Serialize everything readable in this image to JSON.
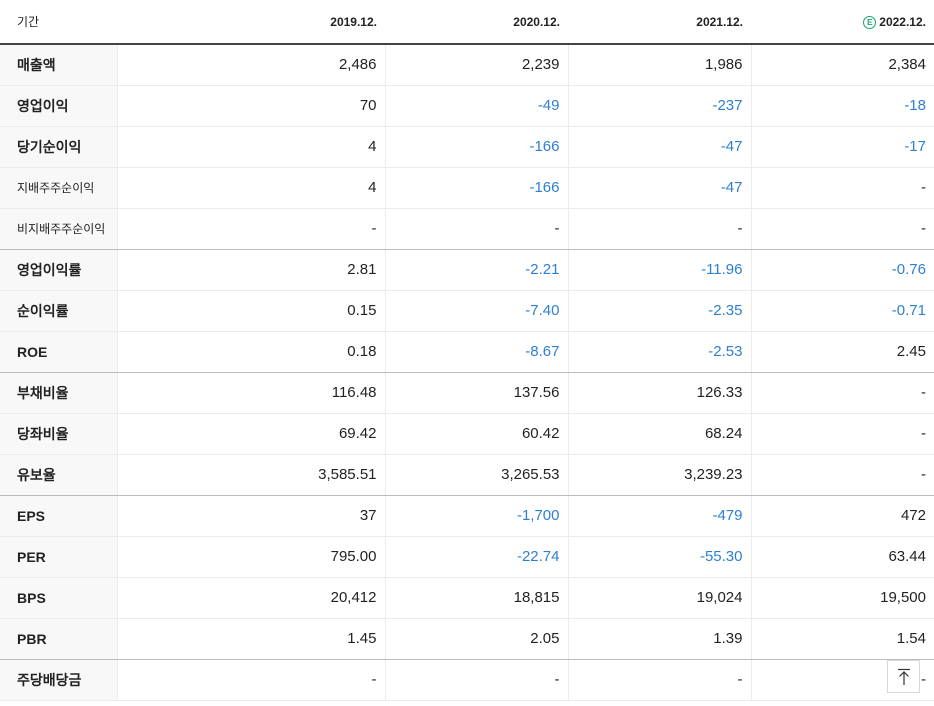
{
  "header": {
    "label": "기간",
    "periods": [
      "2019.12.",
      "2020.12.",
      "2021.12.",
      "2022.12."
    ],
    "estimate_marker": "E"
  },
  "rows": [
    {
      "label": "매출액",
      "values": [
        "2,486",
        "2,239",
        "1,986",
        "2,384"
      ]
    },
    {
      "label": "영업이익",
      "values": [
        "70",
        "-49",
        "-237",
        "-18"
      ]
    },
    {
      "label": "당기순이익",
      "values": [
        "4",
        "-166",
        "-47",
        "-17"
      ]
    },
    {
      "label": "지배주주순이익",
      "values": [
        "4",
        "-166",
        "-47",
        "-"
      ]
    },
    {
      "label": "비지배주주순이익",
      "values": [
        "-",
        "-",
        "-",
        "-"
      ]
    },
    {
      "label": "영업이익률",
      "values": [
        "2.81",
        "-2.21",
        "-11.96",
        "-0.76"
      ]
    },
    {
      "label": "순이익률",
      "values": [
        "0.15",
        "-7.40",
        "-2.35",
        "-0.71"
      ]
    },
    {
      "label": "ROE",
      "values": [
        "0.18",
        "-8.67",
        "-2.53",
        "2.45"
      ]
    },
    {
      "label": "부채비율",
      "values": [
        "116.48",
        "137.56",
        "126.33",
        "-"
      ]
    },
    {
      "label": "당좌비율",
      "values": [
        "69.42",
        "60.42",
        "68.24",
        "-"
      ]
    },
    {
      "label": "유보율",
      "values": [
        "3,585.51",
        "3,265.53",
        "3,239.23",
        "-"
      ]
    },
    {
      "label": "EPS",
      "values": [
        "37",
        "-1,700",
        "-479",
        "472"
      ]
    },
    {
      "label": "PER",
      "values": [
        "795.00",
        "-22.74",
        "-55.30",
        "63.44"
      ]
    },
    {
      "label": "BPS",
      "values": [
        "20,412",
        "18,815",
        "19,024",
        "19,500"
      ]
    },
    {
      "label": "PBR",
      "values": [
        "1.45",
        "2.05",
        "1.39",
        "1.54"
      ]
    },
    {
      "label": "주당배당금",
      "values": [
        "-",
        "-",
        "-",
        "-"
      ]
    }
  ],
  "colors": {
    "negative": "#2d7fd3",
    "estimate_icon": "#1aa36a"
  },
  "scroll_top_button": {
    "icon": "arrow-up-to-top-icon"
  }
}
